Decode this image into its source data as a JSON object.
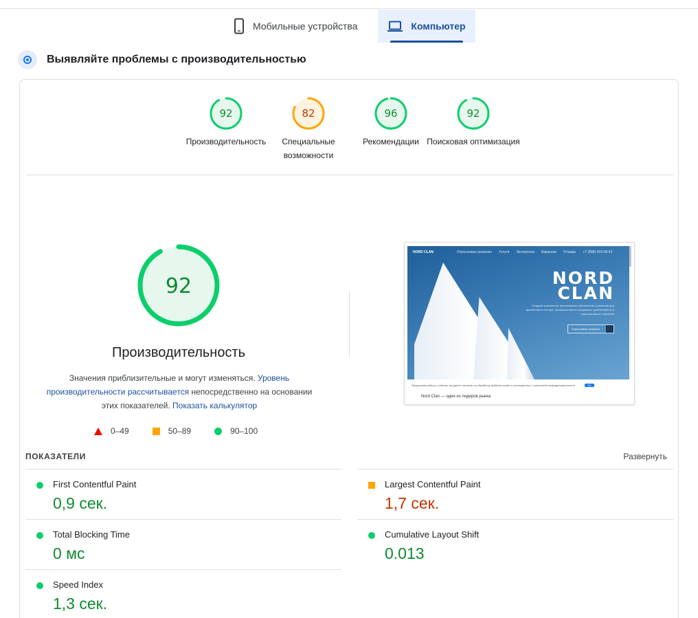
{
  "tabs": {
    "mobile_label": "Мобильные устройства",
    "desktop_label": "Компьютер",
    "active": "desktop"
  },
  "heading": "Выявляйте проблемы с производительностью",
  "colors": {
    "good": "#0cce6b",
    "average": "#ffa400",
    "poor": "#eb0f00",
    "good_text": "#0f8a2f",
    "average_text": "#c33300",
    "accent": "#1a4f9c"
  },
  "scores": [
    {
      "value": 92,
      "label": "Производительность",
      "status": "good"
    },
    {
      "value": 82,
      "label": "Специальные возможности",
      "status": "average"
    },
    {
      "value": 96,
      "label": "Рекомендации",
      "status": "good"
    },
    {
      "value": 92,
      "label": "Поисковая оптимизация",
      "status": "good"
    }
  ],
  "performance": {
    "score": 92,
    "title": "Производительность",
    "desc_part1": "Значения приблизительные и могут изменяться. ",
    "desc_link1": "Уровень производительности рассчитывается",
    "desc_part2": " непосредственно на основании этих показателей. ",
    "desc_link2": "Показать калькулятор"
  },
  "legend": [
    {
      "range": "0–49",
      "shape": "triangle"
    },
    {
      "range": "50–89",
      "shape": "square"
    },
    {
      "range": "90–100",
      "shape": "circle"
    }
  ],
  "screenshot": {
    "nav_brand": "NORD CLAN",
    "nav_items": [
      "Отраслевые решения",
      "Услуги",
      "Экспертиза",
      "Вакансии",
      "Отзывы",
      "+7 (888) 404-08-42"
    ],
    "logo_line1": "NORD",
    "logo_line2": "CLAN",
    "hero_text": "Создаем уникальные программные обеспечения и решения для финансового сектора, промышленности, медицины, девелопмента и корпоративных стартапов",
    "hero_button": "Отраслевые решения",
    "cookie_text": "Продолжая работу с сайтом, вы даете согласие на обработку файлов cookie и соглашаетесь с политикой конфиденциальности",
    "cookie_ok": "ОК",
    "caption": "Nord Clan — один из лидеров рынка"
  },
  "metrics": {
    "title": "ПОКАЗАТЕЛИ",
    "expand_label": "Развернуть",
    "items": [
      {
        "label": "First Contentful Paint",
        "value": "0,9 сек.",
        "status": "good"
      },
      {
        "label": "Largest Contentful Paint",
        "value": "1,7 сек.",
        "status": "average"
      },
      {
        "label": "Total Blocking Time",
        "value": "0 мс",
        "status": "good"
      },
      {
        "label": "Cumulative Layout Shift",
        "value": "0.013",
        "status": "good"
      },
      {
        "label": "Speed Index",
        "value": "1,3 сек.",
        "status": "good"
      }
    ]
  }
}
